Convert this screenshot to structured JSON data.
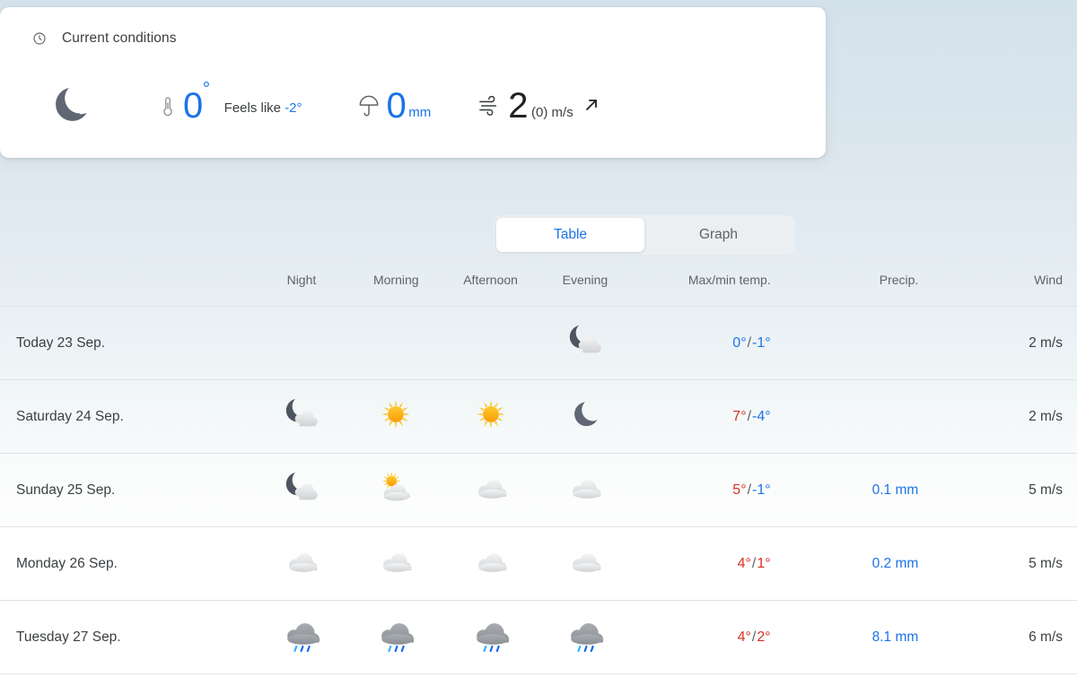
{
  "current": {
    "heading": "Current conditions",
    "heading_icon": "clock-icon",
    "condition_icon": "moon-clear-icon",
    "temperature": "0",
    "temperature_degree": "°",
    "feels_like_label": "Feels like",
    "feels_like_value": "-2°",
    "precip_value": "0",
    "precip_unit": "mm",
    "wind_value": "2",
    "wind_gust": "(0) m/s",
    "wind_direction_icon": "arrow-northeast-icon",
    "thermometer_icon": "thermometer-icon",
    "umbrella_icon": "umbrella-icon",
    "wind_icon": "wind-icon"
  },
  "tabs": {
    "table_label": "Table",
    "graph_label": "Graph",
    "active": "Table"
  },
  "table": {
    "headers": {
      "day": "",
      "night": "Night",
      "morning": "Morning",
      "afternoon": "Afternoon",
      "evening": "Evening",
      "temp": "Max/min temp.",
      "precip": "Precip.",
      "wind": "Wind"
    },
    "rows": [
      {
        "day": "Today 23 Sep.",
        "night_icon": "",
        "morning_icon": "",
        "afternoon_icon": "",
        "evening_icon": "partly-cloudy-night-icon",
        "temp_max": "0°",
        "temp_sep": "/",
        "temp_min": "-1°",
        "max_is_cold": true,
        "precip": "",
        "wind": "2 m/s"
      },
      {
        "day": "Saturday 24 Sep.",
        "night_icon": "partly-cloudy-night-icon",
        "morning_icon": "sunny-icon",
        "afternoon_icon": "sunny-icon",
        "evening_icon": "clear-night-icon",
        "temp_max": "7°",
        "temp_sep": "/",
        "temp_min": "-4°",
        "max_is_cold": false,
        "precip": "",
        "wind": "2 m/s"
      },
      {
        "day": "Sunday 25 Sep.",
        "night_icon": "partly-cloudy-night-icon",
        "morning_icon": "partly-cloudy-day-icon",
        "afternoon_icon": "cloudy-icon",
        "evening_icon": "cloudy-icon",
        "temp_max": "5°",
        "temp_sep": "/",
        "temp_min": "-1°",
        "max_is_cold": false,
        "precip": "0.1 mm",
        "wind": "5 m/s"
      },
      {
        "day": "Monday 26 Sep.",
        "night_icon": "cloudy-icon",
        "morning_icon": "cloudy-icon",
        "afternoon_icon": "cloudy-icon",
        "evening_icon": "cloudy-icon",
        "temp_max": "4°",
        "temp_sep": "/",
        "temp_min": "1°",
        "max_is_cold": false,
        "min_is_warm": true,
        "precip": "0.2 mm",
        "wind": "5 m/s"
      },
      {
        "day": "Tuesday 27 Sep.",
        "night_icon": "rain-icon",
        "morning_icon": "rain-icon",
        "afternoon_icon": "rain-icon",
        "evening_icon": "rain-icon",
        "temp_max": "4°",
        "temp_sep": "/",
        "temp_min": "2°",
        "max_is_cold": false,
        "min_is_warm": true,
        "precip": "8.1 mm",
        "wind": "6 m/s"
      }
    ]
  },
  "colors": {
    "blue": "#1a73e8",
    "red": "#d93025",
    "text": "#3c4043",
    "muted": "#5f6368"
  }
}
